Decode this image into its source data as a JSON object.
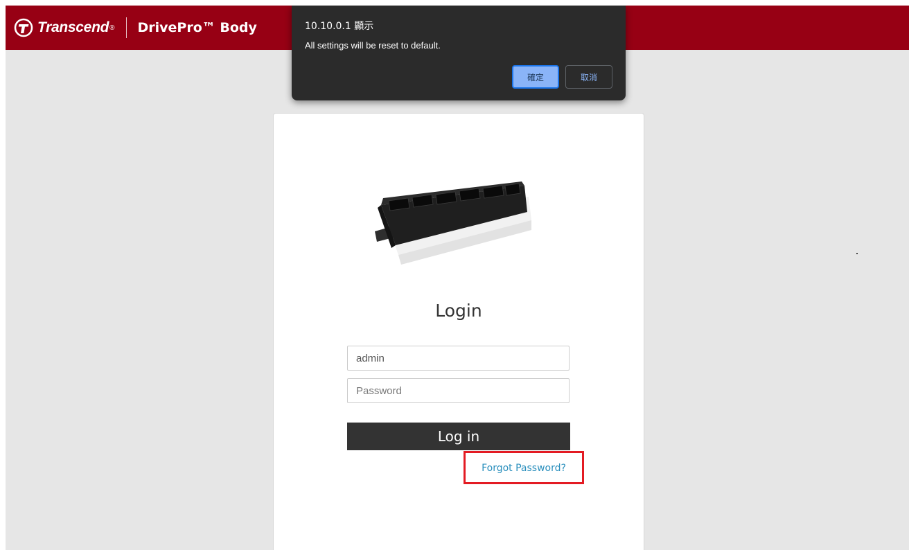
{
  "header": {
    "brand_name": "Transcend",
    "brand_reg": "®",
    "product_name": "DrivePro™ Body"
  },
  "dialog": {
    "origin": "10.10.0.1 顯示",
    "message": "All settings will be reset to default.",
    "ok_label": "確定",
    "cancel_label": "取消"
  },
  "login": {
    "title": "Login",
    "username_value": "admin",
    "password_placeholder": "Password",
    "login_button": "Log in",
    "forgot_link": "Forgot Password?"
  },
  "colors": {
    "header_bg": "#970014",
    "page_bg": "#e6e6e6",
    "dialog_bg": "#2b2b2b",
    "ok_button": "#8ab4f8",
    "link": "#2a8fbd",
    "highlight_box": "#e31b23",
    "login_button_bg": "#333333"
  },
  "icons": {
    "brand": "transcend-logo-icon",
    "product": "docking-station-image"
  }
}
